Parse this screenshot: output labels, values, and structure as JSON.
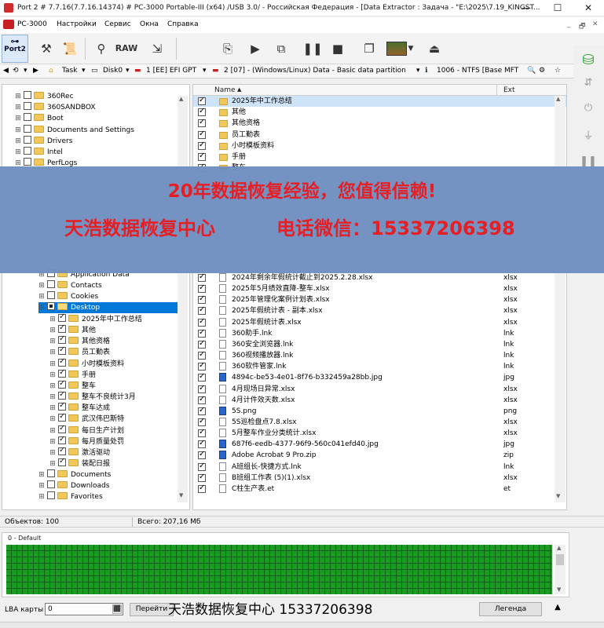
{
  "window": {
    "title": "Port 2 # 7.7.16(7.7.16.14374) # PC-3000 Portable-III (x64) /USB 3.0/ - Российская Федерация - [Data Extractor : Задача - \"E:\\2025\\7.19_KINGST...",
    "minimize": "—",
    "maximize": "☐",
    "close": "✕"
  },
  "menu": {
    "items": [
      "PC-3000",
      "Настройки",
      "Сервис",
      "Окна",
      "Справка"
    ],
    "mdi_controls": [
      "_",
      "🗗",
      "✕"
    ]
  },
  "toolbar": {
    "port_label_1": "Port",
    "port_label_2": "2",
    "raw_label": "RAW"
  },
  "pathbar": {
    "task": "Task",
    "disk": "Disk0",
    "partition1": "1 [EE] EFI GPT",
    "partition2": "2 [07] - (Windows/Linux) Data - Basic data partition",
    "fs": "1006 - NTFS [Base MFT"
  },
  "tree": {
    "top_items": [
      "360Rec",
      "360SANDBOX",
      "Boot",
      "Documents and Settings",
      "Drivers",
      "Intel",
      "PerfLogs"
    ],
    "user_items": [
      "Application Data",
      "Contacts",
      "Cookies"
    ],
    "selected": "Desktop",
    "desktop_children": [
      "2025年中工作总结",
      "其他",
      "其他资格",
      "员工勤表",
      "小时模板资料",
      "手册",
      "整车",
      "整车不良统计3月",
      "整车达成",
      "武汉伟巴斯特",
      "每日生产计划",
      "每月质量处罚",
      "激活驱动",
      "装配日报"
    ],
    "bottom_items": [
      "Documents",
      "Downloads",
      "Favorites"
    ]
  },
  "filelist": {
    "col_name": "Name",
    "col_ext": "Ext",
    "top_rows": [
      {
        "name": "2025年中工作总结",
        "ext": "",
        "type": "folder"
      },
      {
        "name": "其他",
        "ext": "",
        "type": "folder"
      },
      {
        "name": "其他资格",
        "ext": "",
        "type": "folder"
      },
      {
        "name": "员工勤表",
        "ext": "",
        "type": "folder"
      },
      {
        "name": "小时模板资料",
        "ext": "",
        "type": "folder"
      },
      {
        "name": "手册",
        "ext": "",
        "type": "folder"
      },
      {
        "name": "整车",
        "ext": "",
        "type": "folder"
      }
    ],
    "rows": [
      {
        "name": "2024年剩余年假统计截止到2025.2.28.xlsx",
        "ext": "xlsx",
        "type": "file"
      },
      {
        "name": "2025年5月绩效直降-整车.xlsx",
        "ext": "xlsx",
        "type": "file"
      },
      {
        "name": "2025年管理化案例计划表.xlsx",
        "ext": "xlsx",
        "type": "file"
      },
      {
        "name": "2025年假统计表 - 副本.xlsx",
        "ext": "xlsx",
        "type": "file"
      },
      {
        "name": "2025年假统计表.xlsx",
        "ext": "xlsx",
        "type": "file"
      },
      {
        "name": "360助手.lnk",
        "ext": "lnk",
        "type": "file"
      },
      {
        "name": "360安全浏览器.lnk",
        "ext": "lnk",
        "type": "file"
      },
      {
        "name": "360视频播放器.lnk",
        "ext": "lnk",
        "type": "file"
      },
      {
        "name": "360软件管家.lnk",
        "ext": "lnk",
        "type": "file"
      },
      {
        "name": "4894c-be53-4e01-8f76-b332459a28bb.jpg",
        "ext": "jpg",
        "type": "img"
      },
      {
        "name": "4月现场日异常.xlsx",
        "ext": "xlsx",
        "type": "file"
      },
      {
        "name": "4月计件效天数.xlsx",
        "ext": "xlsx",
        "type": "file"
      },
      {
        "name": "5S.png",
        "ext": "png",
        "type": "img"
      },
      {
        "name": "5S巡检盘点7.8.xlsx",
        "ext": "xlsx",
        "type": "file"
      },
      {
        "name": "5月整车作业分类统计.xlsx",
        "ext": "xlsx",
        "type": "file"
      },
      {
        "name": "687f6-eedb-4377-96f9-560c041efd40.jpg",
        "ext": "jpg",
        "type": "img"
      },
      {
        "name": "Adobe Acrobat 9 Pro.zip",
        "ext": "zip",
        "type": "img"
      },
      {
        "name": "A班组长-快捷方式.lnk",
        "ext": "lnk",
        "type": "file"
      },
      {
        "name": "B班组工作表 (5)(1).xlsx",
        "ext": "xlsx",
        "type": "file"
      },
      {
        "name": "C柱生产表.et",
        "ext": "et",
        "type": "file"
      }
    ]
  },
  "banner": {
    "line1": "20年数据恢复经验，您值得信赖!",
    "line2a": "天浩数据恢复中心",
    "line2b": "电话微信：15337206398"
  },
  "status": {
    "objects": "Объектов: 100",
    "total": "Всего: 207,16 Мб"
  },
  "map": {
    "label": "0 - Default"
  },
  "bottom": {
    "lba_label": "LBA карты",
    "lba_value": "0",
    "goto_label": "Перейти",
    "legend_label": "Легенда",
    "footer_text": "天浩数据恢复中心 15337206398"
  }
}
